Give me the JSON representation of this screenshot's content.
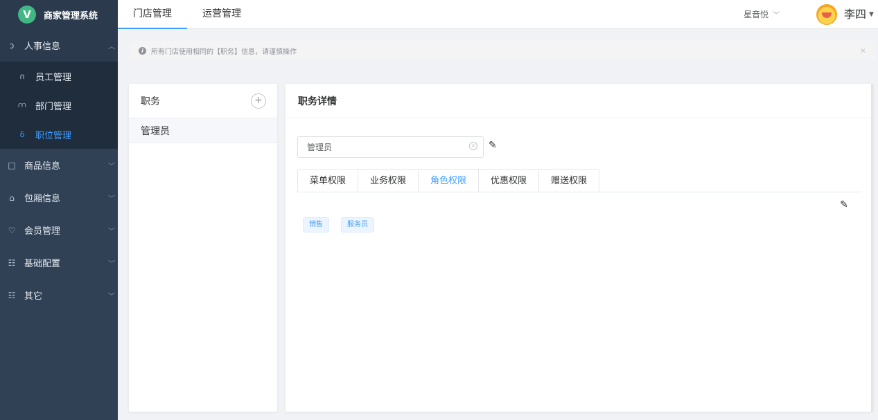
{
  "app": {
    "title": "商家管理系统",
    "logo_letter": "V",
    "logo_color": "#41b883"
  },
  "sidebar": {
    "items": [
      {
        "label": "人事信息",
        "icon": "user-icon",
        "glyph": "ɔ",
        "expanded": true,
        "children": [
          {
            "label": "员工管理",
            "icon": "people-icon",
            "glyph": "∩"
          },
          {
            "label": "部门管理",
            "icon": "org-chart-icon",
            "glyph": "⩋"
          },
          {
            "label": "职位管理",
            "icon": "badge-icon",
            "glyph": "δ",
            "active": true
          }
        ]
      },
      {
        "label": "商品信息",
        "icon": "box-icon",
        "glyph": "□"
      },
      {
        "label": "包厢信息",
        "icon": "home-icon",
        "glyph": "⌂"
      },
      {
        "label": "会员管理",
        "icon": "crown-icon",
        "glyph": "♡"
      },
      {
        "label": "基础配置",
        "icon": "grid-icon",
        "glyph": "☷"
      },
      {
        "label": "其它",
        "icon": "apps-icon",
        "glyph": "☷"
      }
    ]
  },
  "header": {
    "tabs": [
      {
        "label": "门店管理",
        "active": true
      },
      {
        "label": "运营管理",
        "active": false
      }
    ],
    "store_name": "星音悦",
    "user_name": "李四"
  },
  "alert": {
    "text": "所有门店使用相同的【职务】信息，请谨慎操作",
    "close_symbol": "×"
  },
  "positions_panel": {
    "title": "职务",
    "add_symbol": "+",
    "items": [
      "管理员"
    ]
  },
  "detail_panel": {
    "title": "职务详情",
    "name_value": "管理员",
    "tabs": [
      {
        "label": "菜单权限"
      },
      {
        "label": "业务权限"
      },
      {
        "label": "角色权限",
        "active": true
      },
      {
        "label": "优惠权限"
      },
      {
        "label": "赠送权限"
      }
    ],
    "role_tags": [
      "销售",
      "服务员"
    ]
  },
  "colors": {
    "sidebar_bg": "#304156",
    "accent": "#409eff",
    "tag_bg": "#ecf5ff"
  }
}
